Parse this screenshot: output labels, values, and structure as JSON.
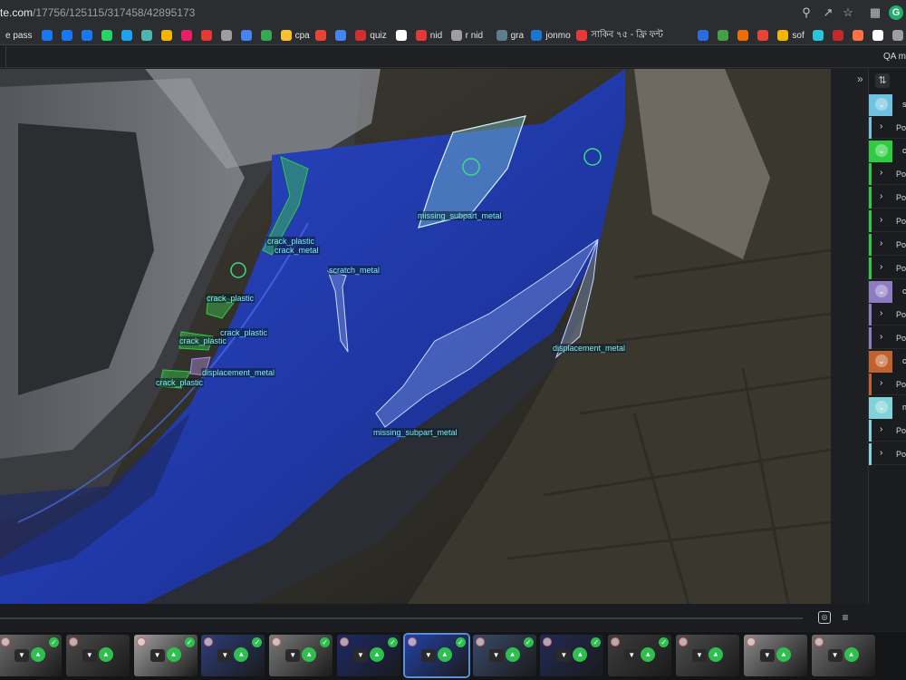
{
  "browser": {
    "url_host": "te.com",
    "url_path": "/17756/125115/317458/42895173",
    "toolbar_icons": [
      "zoom-icon",
      "share-icon",
      "star-icon"
    ],
    "profile_initial": "G"
  },
  "bookmarks": [
    {
      "label": "e pass",
      "color": "#2b2d30"
    },
    {
      "label": "",
      "color": "#1877f2"
    },
    {
      "label": "",
      "color": "#1877f2"
    },
    {
      "label": "",
      "color": "#1877f2"
    },
    {
      "label": "",
      "color": "#25d366"
    },
    {
      "label": "",
      "color": "#1da1f2"
    },
    {
      "label": "",
      "color": "#4db6ac"
    },
    {
      "label": "",
      "color": "#f4b400"
    },
    {
      "label": "",
      "color": "#e91e63"
    },
    {
      "label": "",
      "color": "#e53935"
    },
    {
      "label": "",
      "color": "#9e9e9e"
    },
    {
      "label": "",
      "color": "#4285f4"
    },
    {
      "label": "",
      "color": "#34a853"
    },
    {
      "label": "cpa",
      "color": "#fbc02d"
    },
    {
      "label": "",
      "color": "#ea4335"
    },
    {
      "label": "",
      "color": "#4285f4"
    },
    {
      "label": "quiz",
      "color": "#d32f2f"
    },
    {
      "label": "",
      "color": "#ffffff"
    },
    {
      "label": "nid",
      "color": "#e53935"
    },
    {
      "label": "r nid",
      "color": "#9e9e9e"
    },
    {
      "label": "gra",
      "color": "#607d8b"
    },
    {
      "label": "jonmo",
      "color": "#1976d2"
    },
    {
      "label": "সাকিব ৭৫ - ফ্রি ফন্ট",
      "color": "#e53935"
    },
    {
      "label": "",
      "color": "#2d6cdf"
    },
    {
      "label": "",
      "color": "#43a047"
    },
    {
      "label": "",
      "color": "#ef6c00"
    },
    {
      "label": "",
      "color": "#ea4335"
    },
    {
      "label": "sof",
      "color": "#f4b400"
    },
    {
      "label": "",
      "color": "#26c6da"
    },
    {
      "label": "",
      "color": "#c62828"
    },
    {
      "label": "",
      "color": "#ff7043"
    },
    {
      "label": "",
      "color": "#ffffff"
    },
    {
      "label": "",
      "color": "#9e9e9e"
    }
  ],
  "app": {
    "qa_label": "QA mo"
  },
  "annotations": [
    {
      "label": "missing_subpart_metal"
    },
    {
      "label": "crack_plastic"
    },
    {
      "label": "crack_metal"
    },
    {
      "label": "scratch_metal"
    },
    {
      "label": "crack_plastic"
    },
    {
      "label": "crack_plastic"
    },
    {
      "label": "crack_plastic"
    },
    {
      "label": "displacement_metal"
    },
    {
      "label": "crack_plastic"
    },
    {
      "label": "displacement_metal"
    },
    {
      "label": "missing_subpart_metal"
    }
  ],
  "panel": {
    "top_icon": "filter-icon",
    "groups": [
      {
        "name": "s",
        "color": "#6fc2e0",
        "rows": [
          "Poi"
        ]
      },
      {
        "name": "c",
        "color": "#2ecc40",
        "rows": [
          "Poi",
          "Poi",
          "Poi",
          "Poi",
          "Poi"
        ]
      },
      {
        "name": "c",
        "color": "#8e7cc3",
        "rows": [
          "Poi",
          "Poi"
        ]
      },
      {
        "name": "c",
        "color": "#c0622d",
        "rows": [
          "Poi"
        ]
      },
      {
        "name": "n",
        "color": "#7fd3d9",
        "rows": [
          "Poi",
          "Poi"
        ]
      }
    ]
  },
  "thumbnails": [
    {
      "tone": "#6c6c6c",
      "active": false,
      "approved": true
    },
    {
      "tone": "#4a4a4a",
      "active": false,
      "approved": false
    },
    {
      "tone": "#a0a0a0",
      "active": false,
      "approved": true
    },
    {
      "tone": "#2d3d7a",
      "active": false,
      "approved": true
    },
    {
      "tone": "#7a7a7a",
      "active": false,
      "approved": true
    },
    {
      "tone": "#1d2a66",
      "active": false,
      "approved": true
    },
    {
      "tone": "#2442a8",
      "active": true,
      "approved": true
    },
    {
      "tone": "#3a4a6a",
      "active": false,
      "approved": true
    },
    {
      "tone": "#222a55",
      "active": false,
      "approved": true
    },
    {
      "tone": "#3c3c3c",
      "active": false,
      "approved": true
    },
    {
      "tone": "#4d4d4d",
      "active": false,
      "approved": false
    },
    {
      "tone": "#8a8a8a",
      "active": false,
      "approved": false
    },
    {
      "tone": "#6e6e6e",
      "active": false,
      "approved": false
    }
  ]
}
